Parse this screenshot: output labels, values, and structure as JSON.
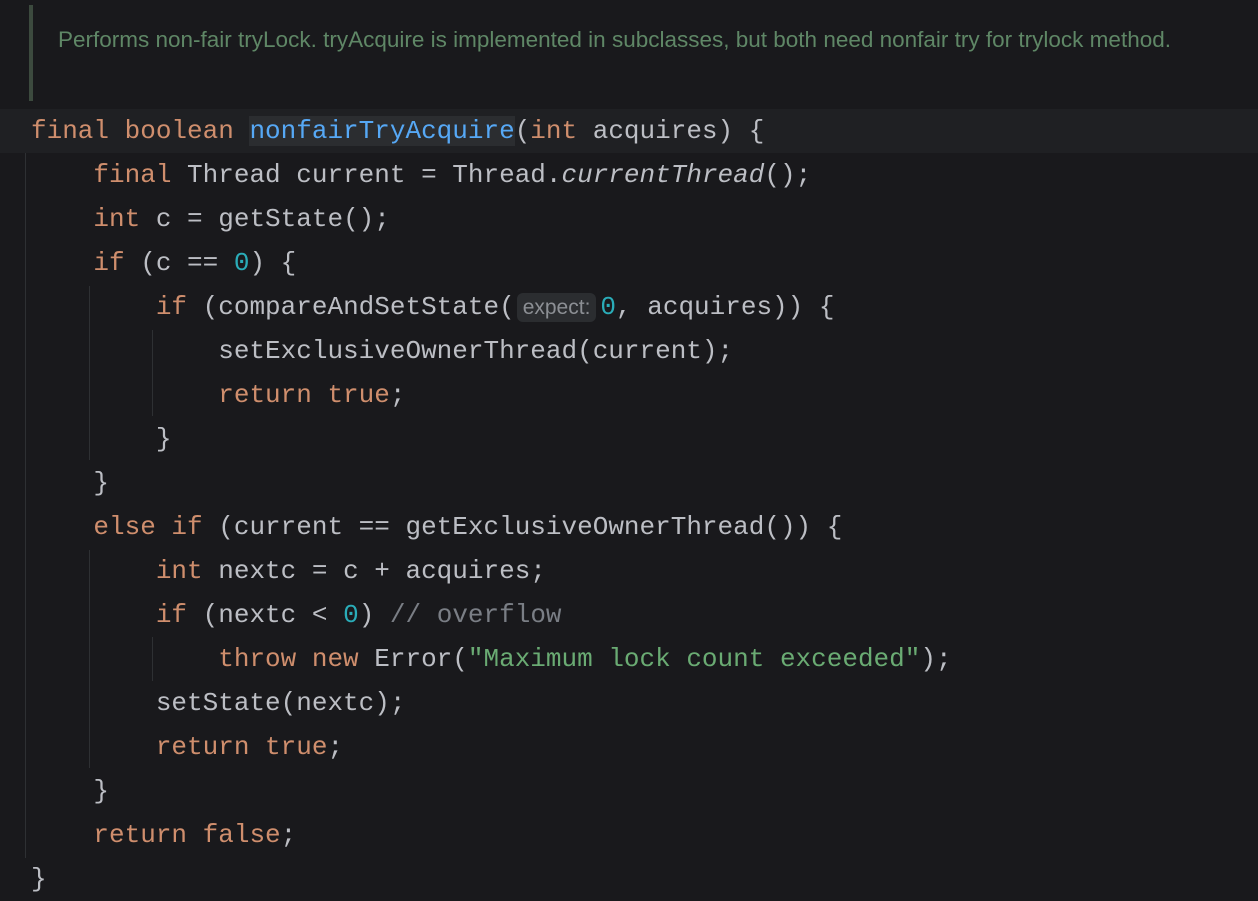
{
  "doc_comment": "Performs non-fair tryLock. tryAcquire is implemented in subclasses, but both need nonfair try for trylock method.",
  "colors": {
    "keyword": "#cf8e6d",
    "function": "#56a8f5",
    "number": "#2aacb8",
    "string": "#6aab73",
    "comment": "#7a7e85",
    "text": "#bcbec4"
  },
  "lines": [
    [
      [
        "kw",
        "final boolean "
      ],
      [
        "fn",
        "nonfairTryAcquire"
      ],
      [
        "p",
        "("
      ],
      [
        "kw",
        "int "
      ],
      [
        "p",
        "acquires) {"
      ]
    ],
    [
      [
        "p",
        "    "
      ],
      [
        "kw",
        "final "
      ],
      [
        "p",
        "Thread current = Thread."
      ],
      [
        "it",
        "currentThread"
      ],
      [
        "p",
        "();"
      ]
    ],
    [
      [
        "p",
        "    "
      ],
      [
        "kw",
        "int "
      ],
      [
        "p",
        "c = getState();"
      ]
    ],
    [
      [
        "p",
        "    "
      ],
      [
        "kw",
        "if "
      ],
      [
        "p",
        "(c == "
      ],
      [
        "num",
        "0"
      ],
      [
        "p",
        ") {"
      ]
    ],
    [
      [
        "p",
        "        "
      ],
      [
        "kw",
        "if "
      ],
      [
        "p",
        "(compareAndSetState("
      ],
      [
        "hint",
        "expect:"
      ],
      [
        "num",
        "0"
      ],
      [
        "p",
        ", acquires)) {"
      ]
    ],
    [
      [
        "p",
        "            setExclusiveOwnerThread(current);"
      ]
    ],
    [
      [
        "p",
        "            "
      ],
      [
        "kw",
        "return true"
      ],
      [
        "p",
        ";"
      ]
    ],
    [
      [
        "p",
        "        }"
      ]
    ],
    [
      [
        "p",
        "    }"
      ]
    ],
    [
      [
        "p",
        "    "
      ],
      [
        "kw",
        "else if "
      ],
      [
        "p",
        "(current == getExclusiveOwnerThread()) {"
      ]
    ],
    [
      [
        "p",
        "        "
      ],
      [
        "kw",
        "int "
      ],
      [
        "p",
        "nextc = c + acquires;"
      ]
    ],
    [
      [
        "p",
        "        "
      ],
      [
        "kw",
        "if "
      ],
      [
        "p",
        "(nextc < "
      ],
      [
        "num",
        "0"
      ],
      [
        "p",
        ") "
      ],
      [
        "cmt",
        "// overflow"
      ]
    ],
    [
      [
        "p",
        "            "
      ],
      [
        "kw",
        "throw new "
      ],
      [
        "p",
        "Error("
      ],
      [
        "str",
        "\"Maximum lock count exceeded\""
      ],
      [
        "p",
        ");"
      ]
    ],
    [
      [
        "p",
        "        setState(nextc);"
      ]
    ],
    [
      [
        "p",
        "        "
      ],
      [
        "kw",
        "return true"
      ],
      [
        "p",
        ";"
      ]
    ],
    [
      [
        "p",
        "    }"
      ]
    ],
    [
      [
        "p",
        "    "
      ],
      [
        "kw",
        "return false"
      ],
      [
        "p",
        ";"
      ]
    ],
    [
      [
        "p",
        "}"
      ]
    ]
  ]
}
